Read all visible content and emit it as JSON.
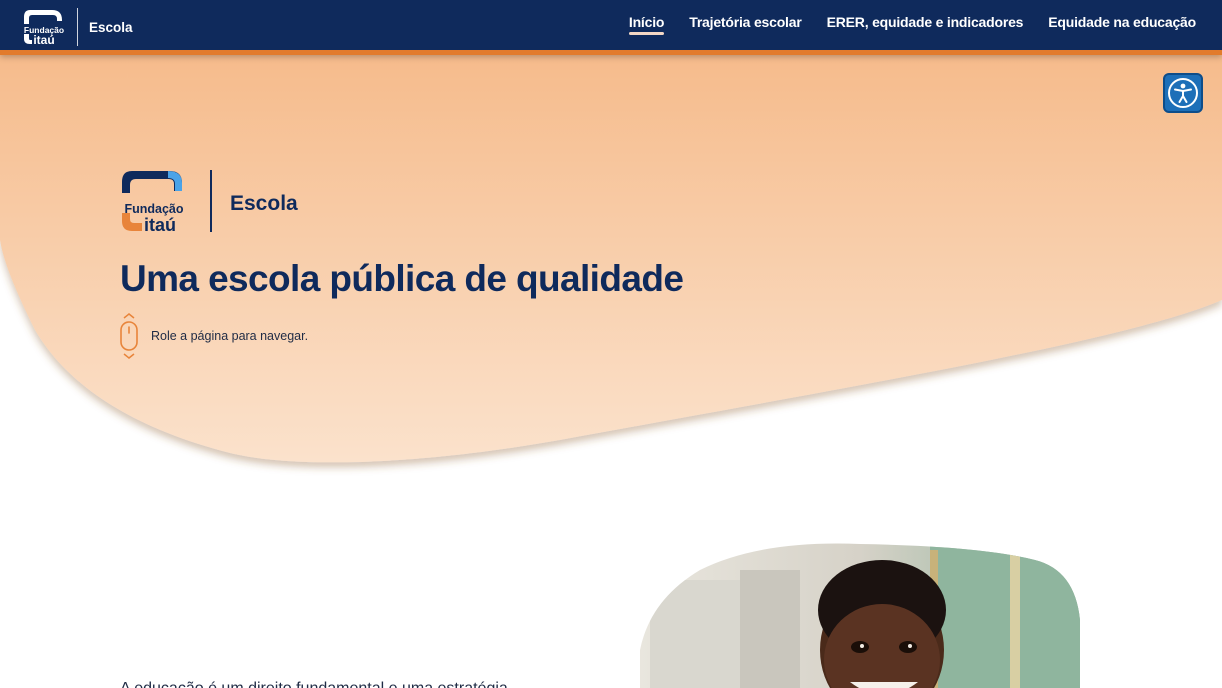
{
  "header": {
    "brand_top": "Fundação",
    "brand_bottom": "itaú",
    "section": "Escola",
    "nav": [
      {
        "label": "Início",
        "active": true
      },
      {
        "label": "Trajetória escolar",
        "active": false
      },
      {
        "label": "ERER, equidade e indicadores",
        "active": false
      },
      {
        "label": "Equidade na educação",
        "active": false
      }
    ]
  },
  "hero": {
    "brand_top": "Fundação",
    "brand_bottom": "itaú",
    "section": "Escola",
    "title": "Uma escola pública de qualidade",
    "scroll_hint": "Role a página para navegar."
  },
  "accessibility": {
    "icon": "accessibility-icon"
  },
  "body": {
    "intro": "A educação é um direito fundamental e uma estratégia"
  },
  "colors": {
    "nav_bg": "#0f2a5c",
    "nav_border": "#e27b2c",
    "hero_top": "#f5b683",
    "hero_bottom": "#fadfc8",
    "title": "#0f2a5c",
    "logo_blue": "#4aa3e8",
    "logo_orange": "#e8843a"
  }
}
